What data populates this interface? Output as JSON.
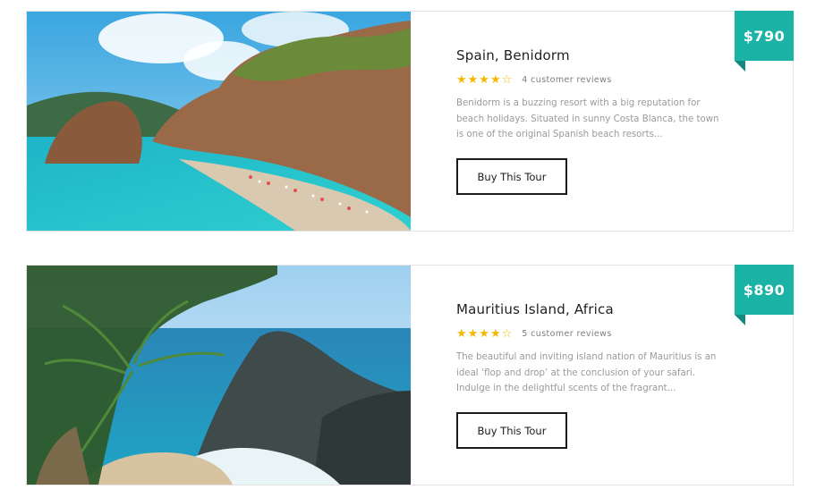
{
  "tours": [
    {
      "title": "Spain, Benidorm",
      "price": "$790",
      "stars": "★★★★☆",
      "reviews": "4 customer reviews",
      "description_lines": [
        "Benidorm is a buzzing resort with a big reputation for",
        "beach holidays. Situated in sunny Costa Blanca, the town",
        "is one of the original Spanish beach resorts..."
      ],
      "button": "Buy This Tour",
      "image": "beach-cliff-photo"
    },
    {
      "title": "Mauritius Island, Africa",
      "price": "$890",
      "stars": "★★★★☆",
      "reviews": "5 customer reviews",
      "description_lines": [
        "The beautiful and inviting island nation of Mauritius is an",
        "ideal ‘flop and drop’ at the conclusion of your safari.",
        "Indulge in the delightful scents of the fragrant..."
      ],
      "button": "Buy This Tour",
      "image": "palm-cove-photo"
    }
  ],
  "colors": {
    "accent": "#1ab3a6",
    "star": "#f5b800",
    "text_muted": "#9a9a9a",
    "border": "#e4e4e4"
  }
}
